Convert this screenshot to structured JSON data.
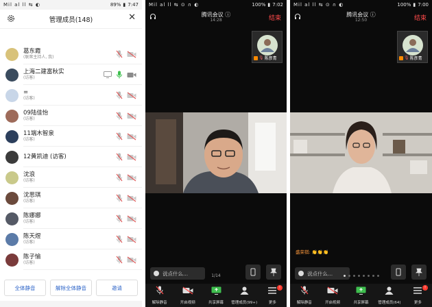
{
  "panel1": {
    "status": {
      "left": "Mil al ll ⇆ ◐",
      "battery": "89%",
      "time": "7:47"
    },
    "title": "管理成员(148)",
    "members": [
      {
        "name": "葛东霞",
        "role": "(联席主持人, 我)",
        "share": false,
        "mic": "muted",
        "cam": "off",
        "avatar": "#d8c27a"
      },
      {
        "name": "上海二建富秋实",
        "role": "(访客)",
        "share": true,
        "mic": "on",
        "cam": "on",
        "avatar": "#3a4b5e"
      },
      {
        "name": "=",
        "role": "(访客)",
        "share": false,
        "mic": "muted",
        "cam": "off",
        "avatar": "#c8d6e8"
      },
      {
        "name": "09陆佳怡",
        "role": "(访客)",
        "share": false,
        "mic": "muted",
        "cam": "off",
        "avatar": "#9e6b5a"
      },
      {
        "name": "11端木智泉",
        "role": "(访客)",
        "share": false,
        "mic": "muted",
        "cam": "off",
        "avatar": "#2c3f5c"
      },
      {
        "name": "12黄凯迪 (访客)",
        "role": "",
        "share": false,
        "mic": "muted",
        "cam": "off",
        "avatar": "#3b3b3b"
      },
      {
        "name": "沈浪",
        "role": "(访客)",
        "share": false,
        "mic": "muted",
        "cam": "off",
        "avatar": "#c9c98a"
      },
      {
        "name": "沈思琪",
        "role": "(访客)",
        "share": false,
        "mic": "muted",
        "cam": "off",
        "avatar": "#6b4a3c"
      },
      {
        "name": "陈娜娜",
        "role": "(访客)",
        "share": false,
        "mic": "muted",
        "cam": "off",
        "avatar": "#555a66"
      },
      {
        "name": "陈天煜",
        "role": "(访客)",
        "share": false,
        "mic": "muted",
        "cam": "off",
        "avatar": "#5b7ba8"
      },
      {
        "name": "陈子愉",
        "role": "(访客)",
        "share": false,
        "mic": "muted",
        "cam": "off",
        "avatar": "#7a3b3b"
      }
    ],
    "buttons": {
      "mute_all": "全体静音",
      "unmute_all": "解除全体静音",
      "invite": "邀请"
    }
  },
  "panel2": {
    "status": {
      "left": "Mil al ll ⇆ ⊙ ∩ ◐",
      "battery": "100%",
      "time": "7:02"
    },
    "meeting_title": "腾讯会议",
    "duration": "14:28",
    "end_label": "结束",
    "thumb_name": "陈彦青",
    "say_placeholder": "说点什么...",
    "page": "1/14",
    "toolbar": [
      {
        "label": "解除静音",
        "icon": "mic-muted-icon"
      },
      {
        "label": "开启视频",
        "icon": "video-off-icon"
      },
      {
        "label": "共享屏幕",
        "icon": "share-screen-icon"
      },
      {
        "label": "管理成员(99+)",
        "icon": "members-icon"
      },
      {
        "label": "更多",
        "icon": "more-icon",
        "badge": "!"
      }
    ]
  },
  "panel3": {
    "status": {
      "left": "Mil al ll ⇆ ⊙ ∩ ◐",
      "battery": "100%",
      "time": "7:00"
    },
    "meeting_title": "腾讯会议",
    "duration": "12:50",
    "end_label": "结束",
    "thumb_name": "陈彦青",
    "reaction": "盛荣祺: 👏👏👏",
    "say_placeholder": "说点什么...",
    "dots": 8,
    "toolbar": [
      {
        "label": "解除静音",
        "icon": "mic-muted-icon"
      },
      {
        "label": "开启视频",
        "icon": "video-off-icon"
      },
      {
        "label": "共享屏幕",
        "icon": "share-screen-icon"
      },
      {
        "label": "管理成员(64)",
        "icon": "members-icon"
      },
      {
        "label": "更多",
        "icon": "more-icon",
        "badge": "!"
      }
    ]
  },
  "colors": {
    "accent": "#2d64c8",
    "mic_on": "#3fbf4f",
    "end": "#ff4a4a",
    "muted": "#e05a5a"
  }
}
